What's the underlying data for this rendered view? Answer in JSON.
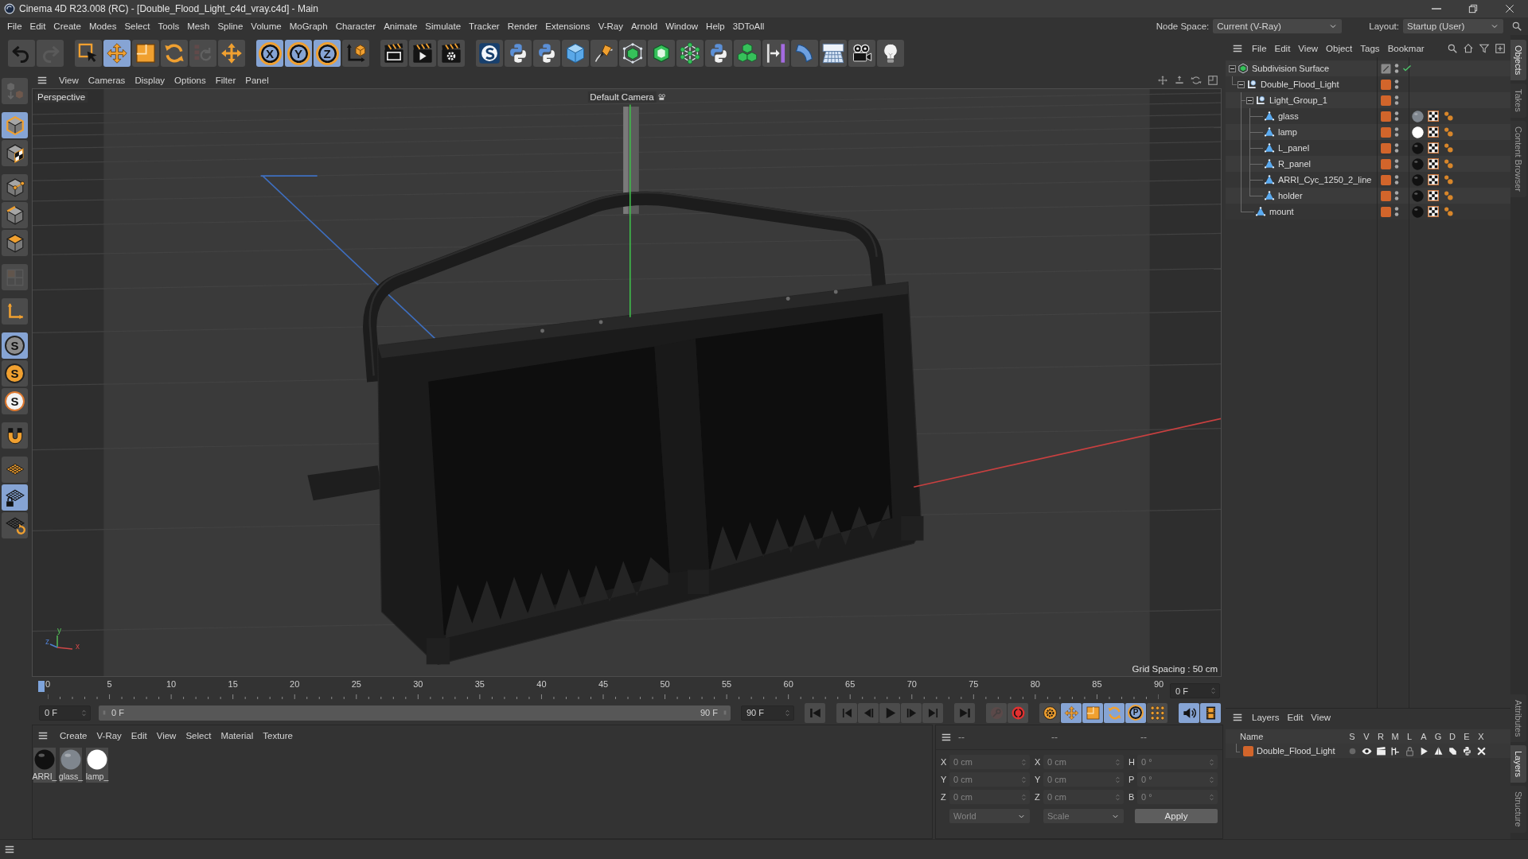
{
  "window": {
    "title": "Cinema 4D R23.008 (RC) - [Double_Flood_Light_c4d_vray.c4d] - Main"
  },
  "menu_bar": {
    "items": [
      "File",
      "Edit",
      "Create",
      "Modes",
      "Select",
      "Tools",
      "Mesh",
      "Spline",
      "Volume",
      "MoGraph",
      "Character",
      "Animate",
      "Simulate",
      "Tracker",
      "Render",
      "Extensions",
      "V-Ray",
      "Arnold",
      "Window",
      "Help",
      "3DToAll"
    ],
    "node_space": {
      "label": "Node Space:",
      "value": "Current (V-Ray)"
    },
    "layout": {
      "label": "Layout:",
      "value": "Startup (User)"
    }
  },
  "toolbar": {
    "groups": [
      [
        {
          "active": false,
          "disabled": false
        },
        {
          "active": false,
          "disabled": true
        }
      ],
      [
        {
          "active": false,
          "disabled": false
        },
        {
          "active": true,
          "disabled": false
        },
        {
          "active": false,
          "disabled": false
        },
        {
          "active": false,
          "disabled": false
        },
        {
          "active": false,
          "disabled": true
        },
        {
          "active": false,
          "disabled": false
        }
      ],
      [
        {
          "label": "X",
          "active": true,
          "disabled": false
        },
        {
          "label": "Y",
          "active": true,
          "disabled": false
        },
        {
          "label": "Z",
          "active": true,
          "disabled": false
        },
        {
          "active": false,
          "disabled": false
        }
      ],
      [
        {
          "active": false,
          "disabled": false
        },
        {
          "active": false,
          "disabled": false
        },
        {
          "active": false,
          "disabled": false
        }
      ],
      [
        {
          "active": false,
          "disabled": false
        },
        {
          "active": false,
          "disabled": false
        },
        {
          "active": false,
          "disabled": false
        },
        {
          "active": false,
          "disabled": false
        },
        {
          "active": false,
          "disabled": false
        },
        {
          "active": false,
          "disabled": false
        },
        {
          "active": false,
          "disabled": false
        },
        {
          "active": false,
          "disabled": false
        },
        {
          "active": false,
          "disabled": false
        },
        {
          "active": false,
          "disabled": false
        },
        {
          "active": false,
          "disabled": false
        },
        {
          "active": false,
          "disabled": false
        },
        {
          "active": false,
          "disabled": false
        },
        {
          "active": false,
          "disabled": false
        },
        {
          "active": false,
          "disabled": false
        }
      ]
    ]
  },
  "mode_toolbar": {
    "groups": [
      [
        {
          "active": false,
          "disabled": true
        }
      ],
      [
        {
          "active": true,
          "disabled": false
        },
        {
          "active": false,
          "disabled": false
        }
      ],
      [
        {
          "active": false,
          "disabled": false
        },
        {
          "active": false,
          "disabled": false
        },
        {
          "active": false,
          "disabled": false
        }
      ],
      [
        {
          "active": false,
          "disabled": true
        }
      ],
      [
        {
          "active": false,
          "disabled": false
        }
      ],
      [
        {
          "label": "S",
          "active": true,
          "disabled": false
        },
        {
          "label": "S",
          "active": false,
          "disabled": false
        },
        {
          "label": "S",
          "active": false,
          "disabled": false
        }
      ],
      [
        {
          "active": false,
          "disabled": false
        }
      ],
      [
        {
          "active": false,
          "disabled": false
        },
        {
          "active": true,
          "disabled": false
        },
        {
          "active": false,
          "disabled": false
        }
      ]
    ]
  },
  "viewport": {
    "menu": [
      "View",
      "Cameras",
      "Display",
      "Options",
      "Filter",
      "Panel"
    ],
    "view_name": "Perspective",
    "camera": "Default Camera",
    "grid_spacing": "Grid Spacing : 50 cm",
    "axis_labels": [
      "y",
      "z",
      "x"
    ]
  },
  "timeline": {
    "frame_labels": [
      "0",
      "5",
      "10",
      "15",
      "20",
      "25",
      "30",
      "35",
      "40",
      "45",
      "50",
      "55",
      "60",
      "65",
      "70",
      "75",
      "80",
      "85",
      "90"
    ],
    "level": 0,
    "current_frame": "0 F",
    "start": "0 F",
    "range_start": "0 F",
    "range_end": "90 F",
    "end": "90 F",
    "transport": [
      [
        {
          "active": false,
          "disabled": false
        }
      ],
      [
        {
          "active": false,
          "disabled": false
        },
        {
          "active": false,
          "disabled": false
        },
        {
          "active": false,
          "disabled": false
        },
        {
          "active": false,
          "disabled": false
        },
        {
          "active": false,
          "disabled": false
        }
      ],
      [
        {
          "active": false,
          "disabled": false
        }
      ],
      [
        {
          "active": false,
          "disabled": true
        },
        {
          "active": false,
          "disabled": false
        }
      ],
      [
        {
          "active": false,
          "disabled": false
        },
        {
          "active": true,
          "disabled": false
        },
        {
          "active": true,
          "disabled": false
        },
        {
          "active": true,
          "disabled": false
        },
        {
          "label": "P",
          "active": true,
          "disabled": false
        },
        {
          "active": false,
          "disabled": false
        }
      ],
      [
        {
          "active": true,
          "disabled": false
        },
        {
          "active": true,
          "disabled": false
        }
      ]
    ]
  },
  "materials": {
    "menu": [
      "Create",
      "V-Ray",
      "Edit",
      "View",
      "Select",
      "Material",
      "Texture"
    ],
    "items": [
      {
        "name": "ARRI_",
        "color": "#111111",
        "selected": false
      },
      {
        "name": "glass_",
        "color": "#7f868e",
        "selected": false
      },
      {
        "name": "lamp_",
        "color": "#ffffff",
        "selected": false
      }
    ]
  },
  "coordinates": {
    "headers": [
      "--",
      "--",
      "--"
    ],
    "rows": [
      [
        {
          "label": "X",
          "value": "0 cm",
          "disabled": true
        },
        {
          "label": "X",
          "value": "0 cm",
          "disabled": true
        },
        {
          "label": "H",
          "value": "0 °",
          "disabled": true
        }
      ],
      [
        {
          "label": "Y",
          "value": "0 cm",
          "disabled": true
        },
        {
          "label": "Y",
          "value": "0 cm",
          "disabled": true
        },
        {
          "label": "P",
          "value": "0 °",
          "disabled": true
        }
      ],
      [
        {
          "label": "Z",
          "value": "0 cm",
          "disabled": true
        },
        {
          "label": "Z",
          "value": "0 cm",
          "disabled": true
        },
        {
          "label": "B",
          "value": "0 °",
          "disabled": true
        }
      ]
    ],
    "dropdowns": [
      {
        "value": "World",
        "disabled": true
      },
      {
        "value": "Scale",
        "disabled": true
      }
    ],
    "apply": "Apply"
  },
  "objects": {
    "menu": [
      "File",
      "Edit",
      "View",
      "Object",
      "Tags",
      "Bookmar"
    ],
    "tree": [
      {
        "name": "Subdivision Surface",
        "kind": "subdivision",
        "expanded": true,
        "enabled": true,
        "selected": false,
        "children": [
          {
            "name": "Double_Flood_Light",
            "kind": "group",
            "color": "#d2652b",
            "expanded": true,
            "enabled": false,
            "selected": false,
            "children": [
              {
                "name": "Light_Group_1",
                "kind": "group",
                "color": "#d2652b",
                "expanded": true,
                "enabled": false,
                "selected": false,
                "children": [
                  {
                    "name": "glass",
                    "kind": "polygon",
                    "color": "#d2652b",
                    "enabled": false,
                    "selected": false,
                    "tags": [
                      {
                        "kind": "material",
                        "color": "#7f868e"
                      },
                      {
                        "kind": "checker"
                      },
                      {
                        "kind": "dots"
                      }
                    ]
                  },
                  {
                    "name": "lamp",
                    "kind": "polygon",
                    "color": "#d2652b",
                    "enabled": false,
                    "selected": false,
                    "tags": [
                      {
                        "kind": "material",
                        "color": "#ffffff"
                      },
                      {
                        "kind": "checker"
                      },
                      {
                        "kind": "dots"
                      }
                    ]
                  },
                  {
                    "name": "L_panel",
                    "kind": "polygon",
                    "color": "#d2652b",
                    "enabled": false,
                    "selected": false,
                    "tags": [
                      {
                        "kind": "material",
                        "color": "#111111"
                      },
                      {
                        "kind": "checker"
                      },
                      {
                        "kind": "dots"
                      }
                    ]
                  },
                  {
                    "name": "R_panel",
                    "kind": "polygon",
                    "color": "#d2652b",
                    "enabled": false,
                    "selected": false,
                    "tags": [
                      {
                        "kind": "material",
                        "color": "#111111"
                      },
                      {
                        "kind": "checker"
                      },
                      {
                        "kind": "dots"
                      }
                    ]
                  },
                  {
                    "name": "ARRI_Cyc_1250_2_line",
                    "kind": "polygon",
                    "color": "#d2652b",
                    "enabled": false,
                    "selected": false,
                    "tags": [
                      {
                        "kind": "material",
                        "color": "#111111"
                      },
                      {
                        "kind": "checker"
                      },
                      {
                        "kind": "dots"
                      }
                    ]
                  },
                  {
                    "name": "holder",
                    "kind": "polygon",
                    "color": "#d2652b",
                    "enabled": false,
                    "selected": false,
                    "tags": [
                      {
                        "kind": "material",
                        "color": "#111111"
                      },
                      {
                        "kind": "checker"
                      },
                      {
                        "kind": "dots"
                      }
                    ]
                  }
                ]
              },
              {
                "name": "mount",
                "kind": "polygon",
                "color": "#d2652b",
                "enabled": false,
                "selected": false,
                "tags": [
                  {
                    "kind": "material",
                    "color": "#111111"
                  },
                  {
                    "kind": "checker"
                  },
                  {
                    "kind": "dots"
                  }
                ]
              }
            ]
          }
        ]
      }
    ]
  },
  "layers": {
    "menu": [
      "Layers",
      "Edit",
      "View"
    ],
    "columns": [
      "Name",
      "S",
      "V",
      "R",
      "M",
      "L",
      "A",
      "G",
      "D",
      "E",
      "X"
    ],
    "rows": [
      {
        "name": "Double_Flood_Light",
        "color": "#d2652b",
        "selected": false,
        "toggles": [
          {
            "on": false
          },
          {
            "on": true
          },
          {
            "on": true
          },
          {
            "on": true
          },
          {
            "on": false
          },
          {
            "on": true
          },
          {
            "on": true
          },
          {
            "on": true
          },
          {
            "on": true
          },
          {
            "on": true
          }
        ]
      }
    ]
  },
  "side_tabs": {
    "top": [
      {
        "label": "Objects",
        "selected": true
      },
      {
        "label": "Takes",
        "selected": false
      },
      {
        "label": "Content Browser",
        "selected": false
      }
    ],
    "bottom": [
      {
        "label": "Attributes",
        "selected": false
      },
      {
        "label": "Layers",
        "selected": true
      },
      {
        "label": "Structure",
        "selected": false
      }
    ]
  }
}
